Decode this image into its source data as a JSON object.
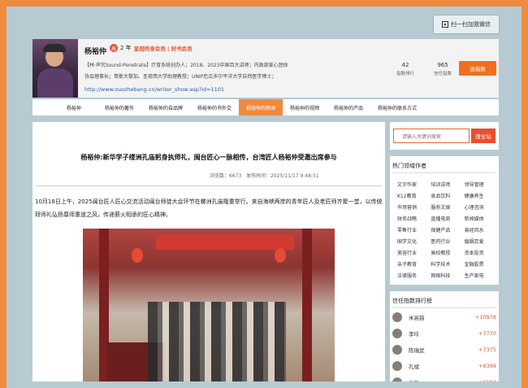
{
  "header": {
    "wechat_button": "扫一扫加我微信"
  },
  "profile": {
    "name": "杨裕仲",
    "level_badge": "高",
    "years": "2 年",
    "member_badges": "皇冠终身会员 | 好书会员",
    "bio_line1": "【林·声究Sound-Penetrate】疗育系统创办人；2018、2023中国百大讲师；内政部爱心团体",
    "bio_line2": "协会理事长；哥斯大黎加、圣荷西大学助理教授；UNIP厄瓜多尔平洋大学自然医学博士；",
    "url": "http://www.zuozhebang.cn/writer_show.asp?id=1101",
    "stats": [
      {
        "value": "42",
        "label": "指数排行"
      },
      {
        "value": "965",
        "label": "信任指数"
      }
    ],
    "tip_button": "送指数"
  },
  "nav": {
    "items": [
      "杨裕仲",
      "杨裕仲的著作",
      "杨裕仲的自品牌",
      "杨裕仲的书外交",
      "杨裕仲的新闻",
      "杨裕仲的视频",
      "杨裕仲的产品",
      "杨裕仲的联系方式"
    ],
    "active_index": 4
  },
  "article": {
    "title": "杨裕仲:新华学子缕洲孔庙躬身执师礼，闽台匠心一脉相传，台湾匠人杨裕仲受邀出席参与",
    "views_label": "浏览数：",
    "views": "6673",
    "published_label": "发布时间：",
    "published": "2025/11/17 9:48:51",
    "paragraph": "10月18日上午，2025闽台匠人匠心交流活动闽台师徒大会环节在螺洲孔庙隆重举行。来自海峡两岸的青年匠人及老匠师齐聚一堂，以传统拜师礼弘扬尊师重道之风，传递薪火相承的匠心精神。"
  },
  "sidebar": {
    "search_placeholder": "请输入关键词搜索",
    "search_button": "搜全站",
    "hot_title": "热门领域作者",
    "hot_items": [
      "文字作家",
      "培训讲师",
      "领导管理",
      "K12教育",
      "食品饮料",
      "健康养生",
      "市场营销",
      "服务文娱",
      "心理咨询",
      "财务战略",
      "直播电商",
      "新闻媒体",
      "零售行业",
      "保健产品",
      "易经风水",
      "国学文化",
      "医药行业",
      "婚姻恋爱",
      "美容行业",
      "高校教授",
      "资本投资",
      "亲子教育",
      "科学技术",
      "金融股票",
      "法律服务",
      "网络科技",
      "生产家电"
    ],
    "rank_title": "信任指数排行榜",
    "rank": [
      {
        "name": "米高猫",
        "score": "+10978"
      },
      {
        "name": "李玲",
        "score": "+7770"
      },
      {
        "name": "陈瑞武",
        "score": "+7375"
      },
      {
        "name": "孔斌",
        "score": "+6399"
      },
      {
        "name": "肖群",
        "score": "+6192"
      }
    ]
  }
}
